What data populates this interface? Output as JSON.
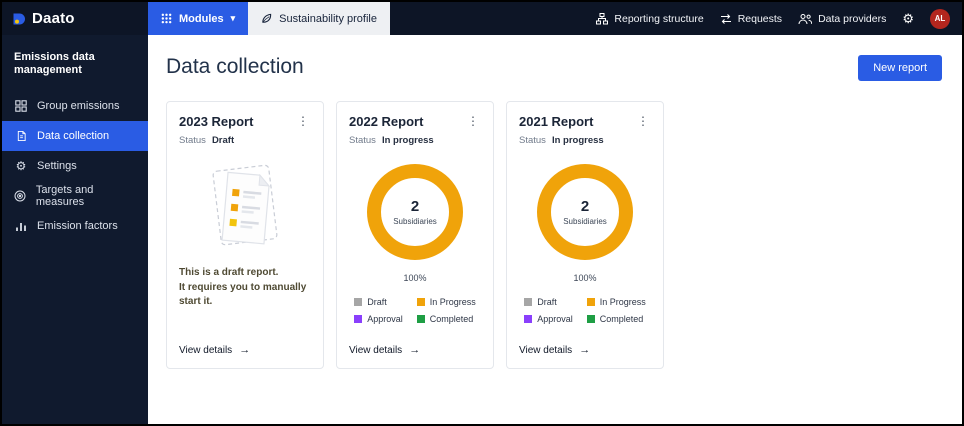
{
  "icons": {
    "kebab": "⋮",
    "arrow_right": "→",
    "gear": "⚙",
    "chevron_down": "▾"
  },
  "topbar": {
    "brand": "Daato",
    "modules": "Modules",
    "sustainability": "Sustainability profile",
    "reporting_structure": "Reporting structure",
    "requests": "Requests",
    "data_providers": "Data providers",
    "avatar_initials": "AL"
  },
  "sidebar": {
    "title": "Emissions data management",
    "items": [
      {
        "label": "Group emissions",
        "active": false
      },
      {
        "label": "Data collection",
        "active": true
      },
      {
        "label": "Settings",
        "active": false
      },
      {
        "label": "Targets and measures",
        "active": false
      },
      {
        "label": "Emission factors",
        "active": false
      }
    ]
  },
  "main": {
    "title": "Data collection",
    "new_report": "New report",
    "cards": [
      {
        "title": "2023 Report",
        "status_label": "Status",
        "status_value": "Draft",
        "note_line1": "This is a draft report.",
        "note_line2": "It requires you to manually start it.",
        "view_details": "View details"
      },
      {
        "title": "2022 Report",
        "status_label": "Status",
        "status_value": "In progress",
        "donut": {
          "count": "2",
          "label": "Subsidiaries",
          "percent": "100%"
        },
        "legend": [
          {
            "label": "Draft",
            "color": "#a6a6a6"
          },
          {
            "label": "In Progress",
            "color": "#f0a30a"
          },
          {
            "label": "Approval",
            "color": "#8a3ffc"
          },
          {
            "label": "Completed",
            "color": "#1e9e44"
          }
        ],
        "view_details": "View details"
      },
      {
        "title": "2021 Report",
        "status_label": "Status",
        "status_value": "In progress",
        "donut": {
          "count": "2",
          "label": "Subsidiaries",
          "percent": "100%"
        },
        "legend": [
          {
            "label": "Draft",
            "color": "#a6a6a6"
          },
          {
            "label": "In Progress",
            "color": "#f0a30a"
          },
          {
            "label": "Approval",
            "color": "#8a3ffc"
          },
          {
            "label": "Completed",
            "color": "#1e9e44"
          }
        ],
        "view_details": "View details"
      }
    ]
  },
  "colors": {
    "topbar_bg": "#0d1526",
    "sidebar_bg": "#101a2e",
    "accent_blue": "#2a5ce4",
    "donut_orange": "#f0a30a",
    "avatar_red": "#b3261e"
  },
  "chart_data": [
    {
      "type": "pie",
      "title": "2022 Report status donut",
      "categories": [
        "Draft",
        "In Progress",
        "Approval",
        "Completed"
      ],
      "values": [
        0,
        100,
        0,
        0
      ],
      "center_value": 2,
      "center_label": "Subsidiaries",
      "annotation": "100%"
    },
    {
      "type": "pie",
      "title": "2021 Report status donut",
      "categories": [
        "Draft",
        "In Progress",
        "Approval",
        "Completed"
      ],
      "values": [
        0,
        100,
        0,
        0
      ],
      "center_value": 2,
      "center_label": "Subsidiaries",
      "annotation": "100%"
    }
  ]
}
